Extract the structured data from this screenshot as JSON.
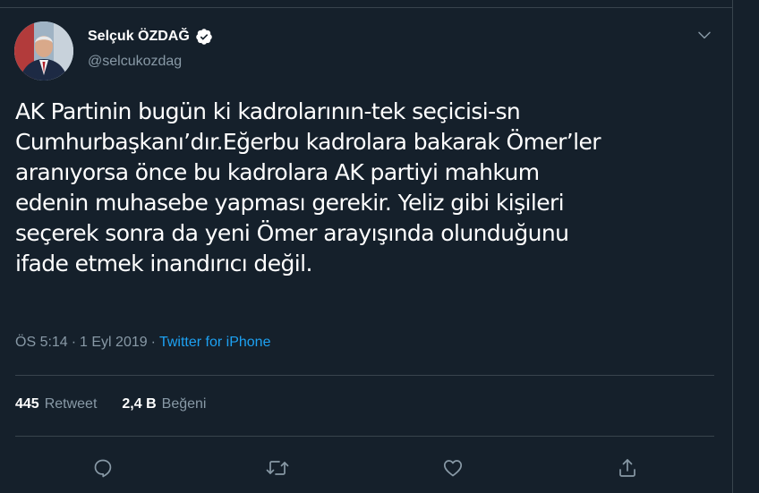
{
  "user": {
    "display_name": "Selçuk ÖZDAĞ",
    "handle": "@selcukozdag",
    "verified": true
  },
  "tweet": {
    "text": "AK Partinin bugün ki kadrolarının-tek seçicisi-sn\nCumhurbaşkanı’dır.Eğerbu kadrolara bakarak Ömer’ler\naranıyorsa önce bu kadrolara AK partiyi mahkum\nedenin muhasebe yapması gerekir. Yeliz gibi kişileri\nseçerek sonra da yeni Ömer arayışında olunduğunu\nifade etmek inandırıcı değil."
  },
  "meta": {
    "time": "ÖS 5:14",
    "separator": "·",
    "date": "1 Eyl 2019",
    "separator2": "·",
    "source": "Twitter for iPhone"
  },
  "stats": {
    "retweets_count": "445",
    "retweets_label": "Retweet",
    "likes_count": "2,4 B",
    "likes_label": "Beğeni"
  },
  "colors": {
    "background": "#15202b",
    "border": "#38444d",
    "secondary_text": "#8899a6",
    "accent": "#1da1f2"
  },
  "icons": {
    "verified": "verified-badge-icon",
    "caret": "chevron-down-icon",
    "reply": "reply-icon",
    "retweet": "retweet-icon",
    "like": "heart-icon",
    "share": "share-icon"
  }
}
